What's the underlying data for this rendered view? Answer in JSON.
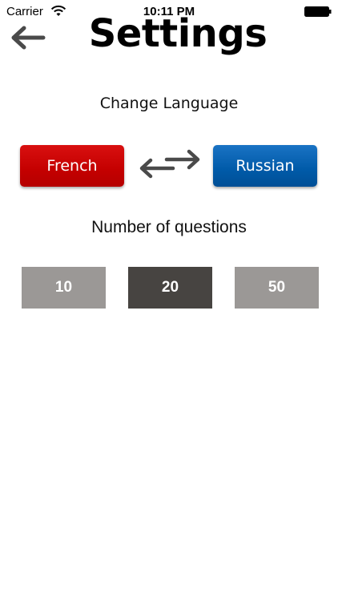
{
  "status_bar": {
    "carrier": "Carrier",
    "time": "10:11 PM",
    "wifi_icon": "wifi-icon",
    "battery_icon": "battery-icon"
  },
  "header": {
    "title": "Settings",
    "back_icon": "back-arrow-icon"
  },
  "language": {
    "section_title": "Change Language",
    "from_label": "French",
    "to_label": "Russian",
    "from_color": "#c40000",
    "to_color": "#005aa8",
    "swap_icon": "swap-arrows-icon"
  },
  "questions": {
    "section_title": "Number of questions",
    "options": [
      "10",
      "20",
      "50"
    ],
    "selected": "20",
    "selected_color": "#474441",
    "unselected_color": "#9b9896"
  }
}
